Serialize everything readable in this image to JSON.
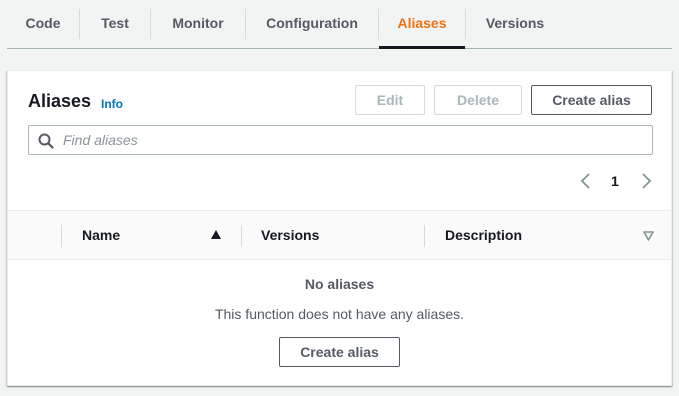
{
  "tabs": [
    {
      "label": "Code",
      "active": false
    },
    {
      "label": "Test",
      "active": false
    },
    {
      "label": "Monitor",
      "active": false
    },
    {
      "label": "Configuration",
      "active": false
    },
    {
      "label": "Aliases",
      "active": true
    },
    {
      "label": "Versions",
      "active": false
    }
  ],
  "panel": {
    "title": "Aliases",
    "info_label": "Info",
    "edit_label": "Edit",
    "delete_label": "Delete",
    "create_label": "Create alias"
  },
  "search": {
    "placeholder": "Find aliases",
    "icon": "search-icon"
  },
  "pagination": {
    "current_page": "1"
  },
  "table": {
    "columns": [
      "Name",
      "Versions",
      "Description"
    ],
    "sort_column": "Name",
    "sort_direction": "ascending"
  },
  "empty_state": {
    "title": "No aliases",
    "description": "This function does not have any aliases.",
    "button_label": "Create alias"
  },
  "colors": {
    "accent": "#ec7211",
    "link": "#0073bb",
    "text": "#16191f",
    "muted": "#545b64"
  }
}
